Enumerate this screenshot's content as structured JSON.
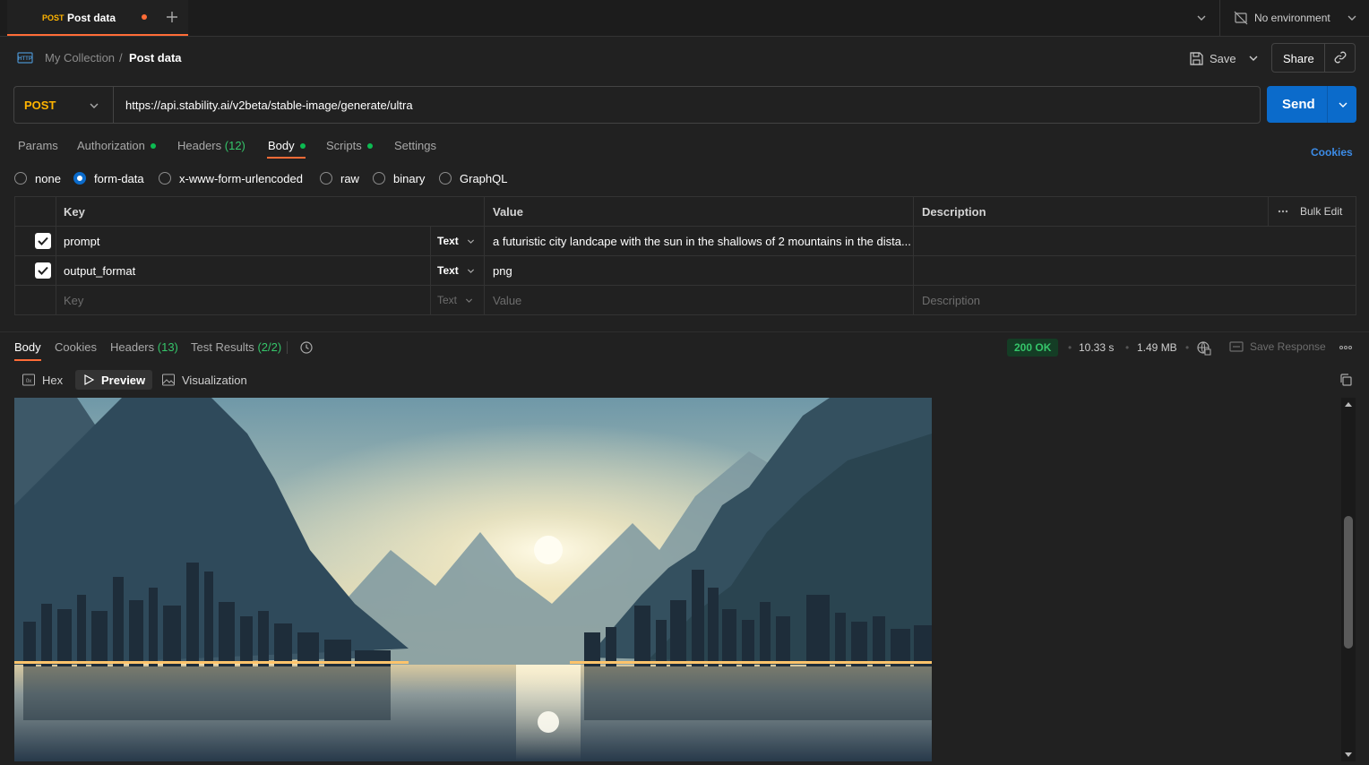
{
  "tab": {
    "method": "POST",
    "name": "Post data"
  },
  "environment": {
    "label": "No environment"
  },
  "breadcrumb": {
    "collection": "My Collection",
    "separator": "/",
    "request": "Post data"
  },
  "toolbar": {
    "save_label": "Save",
    "share_label": "Share"
  },
  "request": {
    "method": "POST",
    "url": "https://api.stability.ai/v2beta/stable-image/generate/ultra",
    "send_label": "Send"
  },
  "request_tabs": {
    "params": "Params",
    "authorization": "Authorization",
    "headers": "Headers",
    "headers_count": "(12)",
    "body": "Body",
    "scripts": "Scripts",
    "settings": "Settings",
    "cookies": "Cookies"
  },
  "body_types": [
    "none",
    "form-data",
    "x-www-form-urlencoded",
    "raw",
    "binary",
    "GraphQL"
  ],
  "body_type_selected": "form-data",
  "form_table": {
    "headers": {
      "key": "Key",
      "value": "Value",
      "description": "Description",
      "bulk_edit": "Bulk Edit"
    },
    "rows": [
      {
        "checked": true,
        "key": "prompt",
        "type": "Text",
        "value": "a futuristic city landcape with the sun in the shallows of 2 mountains in the dista...",
        "description": ""
      },
      {
        "checked": true,
        "key": "output_format",
        "type": "Text",
        "value": "png",
        "description": ""
      }
    ],
    "placeholder": {
      "key": "Key",
      "type": "Text",
      "value": "Value",
      "description": "Description"
    }
  },
  "response": {
    "tabs": {
      "body": "Body",
      "cookies": "Cookies",
      "headers": "Headers",
      "headers_count": "(13)",
      "tests": "Test Results",
      "tests_count": "(2/2)"
    },
    "status": "200 OK",
    "time": "10.33 s",
    "size": "1.49 MB",
    "save_response": "Save Response",
    "view_tabs": {
      "hex": "Hex",
      "preview": "Preview",
      "visualization": "Visualization"
    }
  },
  "colors": {
    "accent": "#ff6c37",
    "send": "#0b6bcb",
    "method": "#ffb400",
    "success": "#35c56a"
  }
}
